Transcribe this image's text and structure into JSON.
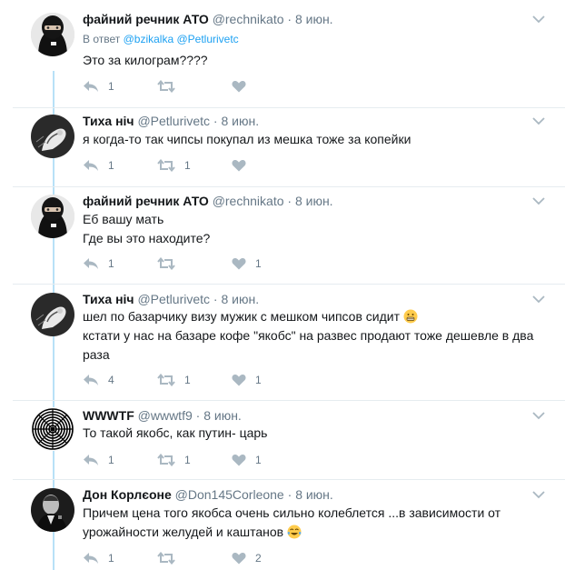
{
  "tweets": [
    {
      "name": "файний речник АТО",
      "handle": "@rechnikato",
      "dot": "·",
      "time": "8 июн.",
      "replying_prefix": "В ответ",
      "replying_users": "@bzikalka @Petlurivetc",
      "lines": [
        "Это за килограм????"
      ],
      "avatar": "balaclava-avatar",
      "reply_count": "1",
      "retweet_count": "",
      "like_count": ""
    },
    {
      "name": "Тиха ніч",
      "handle": "@Petlurivetc",
      "dot": "·",
      "time": "8 июн.",
      "lines": [
        "я когда-то так чипсы покупал из мешка тоже за копейки"
      ],
      "avatar": "sketch-avatar",
      "reply_count": "1",
      "retweet_count": "1",
      "like_count": ""
    },
    {
      "name": "файний речник АТО",
      "handle": "@rechnikato",
      "dot": "·",
      "time": "8 июн.",
      "lines": [
        "Еб вашу мать",
        "Где вы это находите?"
      ],
      "avatar": "balaclava-avatar",
      "reply_count": "1",
      "retweet_count": "",
      "like_count": "1"
    },
    {
      "name": "Тиха ніч",
      "handle": "@Petlurivetc",
      "dot": "·",
      "time": "8 июн.",
      "lines": [
        "шел по базарчику визу мужик с мешком чипсов сидит",
        "кстати у нас на базаре кофе \"якобс\" на развес продают тоже дешевле в два",
        "раза"
      ],
      "emoji_after_line": 0,
      "emoji": "grimacing-emoji",
      "avatar": "sketch-avatar",
      "reply_count": "4",
      "retweet_count": "1",
      "like_count": "1"
    },
    {
      "name": "WWWTF",
      "handle": "@wwwtf9",
      "dot": "·",
      "time": "8 июн.",
      "lines": [
        "То такой якобс, как путин- царь"
      ],
      "avatar": "spiral-avatar",
      "reply_count": "1",
      "retweet_count": "1",
      "like_count": "1"
    },
    {
      "name": "Дон Корлєоне",
      "handle": "@Don145Corleone",
      "dot": "·",
      "time": "8 июн.",
      "lines": [
        "Причем цена того якобса очень сильно колеблется ...в зависимости от",
        "урожайности желудей и каштанов"
      ],
      "emoji_after_line": 1,
      "emoji": "tears-of-joy-emoji",
      "avatar": "godfather-avatar",
      "reply_count": "1",
      "retweet_count": "",
      "like_count": "2"
    }
  ],
  "colors": {
    "thread_line": "#b8e1f7",
    "link": "#1da1f2",
    "meta": "#657786",
    "icon": "#aab8c2"
  }
}
